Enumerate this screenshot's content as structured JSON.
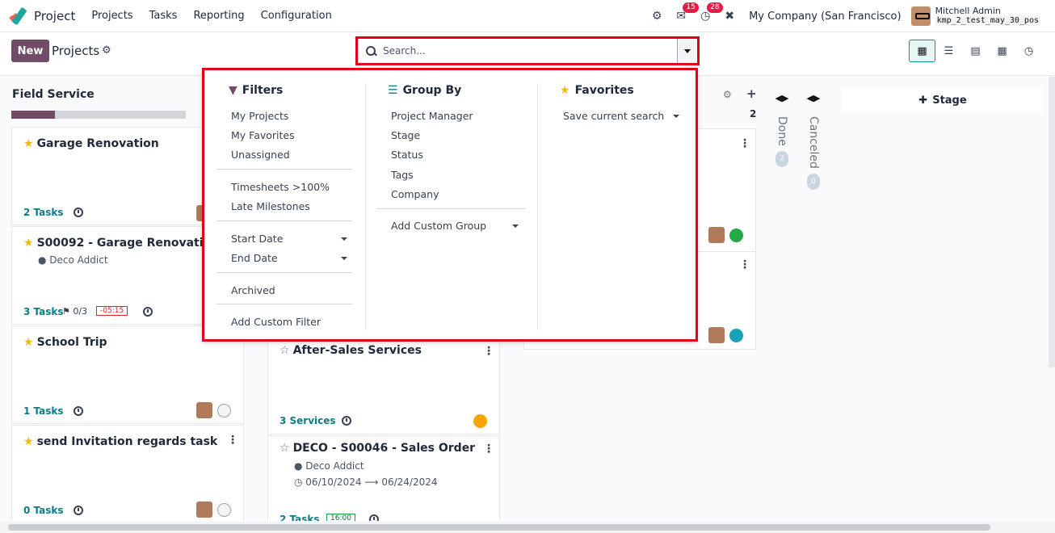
{
  "navbar": {
    "app_name": "Project",
    "menu": [
      "Projects",
      "Tasks",
      "Reporting",
      "Configuration"
    ],
    "messages_badge": "15",
    "activities_badge": "28",
    "company": "My Company (San Francisco)",
    "user_name": "Mitchell Admin",
    "database": "kmp_2_test_may_30_pos"
  },
  "control": {
    "new_label": "New",
    "breadcrumb": "Projects",
    "search_placeholder": "Search..."
  },
  "filters": {
    "title": "Filters",
    "group1": [
      "My Projects",
      "My Favorites",
      "Unassigned"
    ],
    "group2": [
      "Timesheets >100%",
      "Late Milestones"
    ],
    "group3": [
      "Start Date",
      "End Date"
    ],
    "group4": [
      "Archived"
    ],
    "custom": "Add Custom Filter"
  },
  "group_by": {
    "title": "Group By",
    "items": [
      "Project Manager",
      "Stage",
      "Status",
      "Tags",
      "Company"
    ],
    "custom": "Add Custom Group"
  },
  "favorites": {
    "title": "Favorites",
    "save": "Save current search"
  },
  "kanban": {
    "col1_title": "Field Service",
    "col1_progress_fraction": 0.25,
    "col2_count": "2",
    "done_label": "Done",
    "done_count": "2",
    "canceled_label": "Canceled",
    "canceled_count": "0",
    "add_stage": "Stage",
    "cards": [
      {
        "title": "Garage Renovation",
        "foot": "2 Tasks"
      },
      {
        "title": "S00092 - Garage Renovation",
        "sub": "Deco Addict",
        "foot": "3 Tasks",
        "milestone": "0/3",
        "deadline": "-05:15"
      },
      {
        "title": "School Trip",
        "foot": "1 Tasks"
      },
      {
        "title": "send Invitation regards task",
        "foot": "0 Tasks"
      },
      {
        "title": "After-Sales Services",
        "foot": "3 Services"
      },
      {
        "title": "DECO - S00046 - Sales Order",
        "sub": "Deco Addict",
        "date_from": "06/10/2024",
        "date_to": "06/24/2024",
        "foot": "2 Tasks",
        "deadline": "16:00"
      }
    ]
  }
}
